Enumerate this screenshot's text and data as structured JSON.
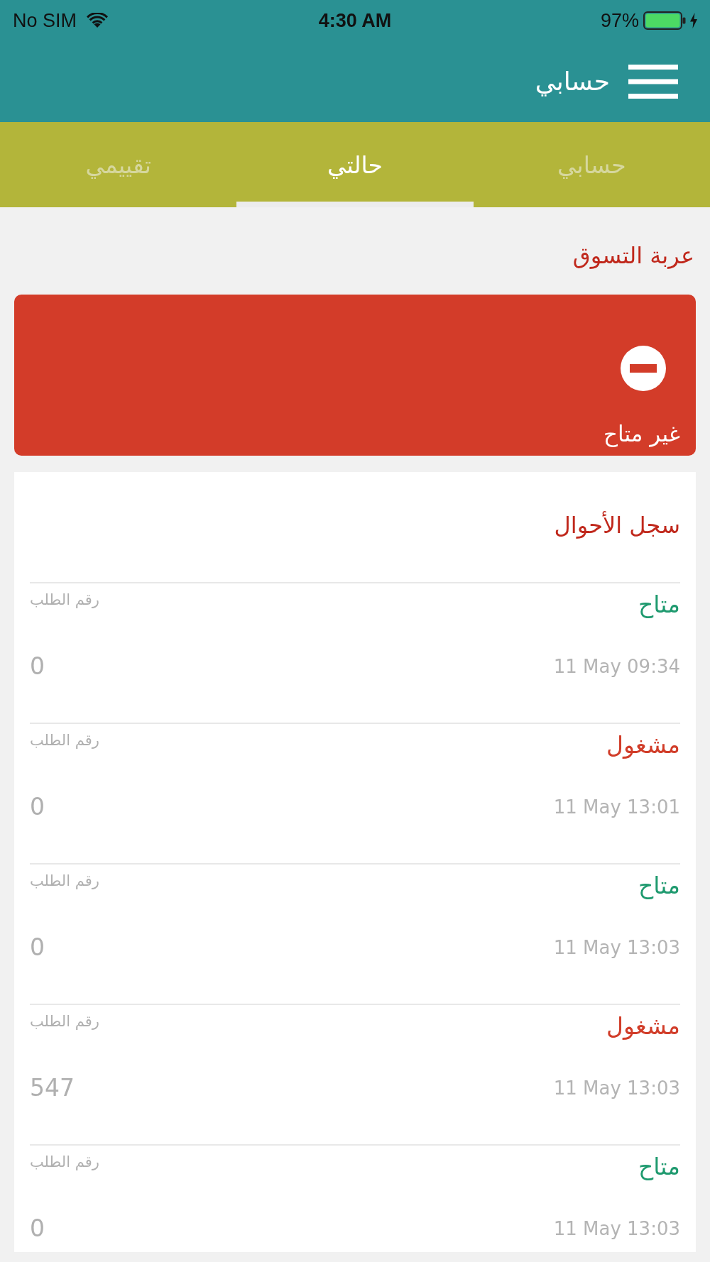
{
  "status_bar": {
    "carrier": "No SIM",
    "time": "4:30 AM",
    "battery": "97%"
  },
  "header": {
    "title": "حسابي"
  },
  "tabs": [
    {
      "label": "حسابي",
      "selected": false
    },
    {
      "label": "حالتي",
      "selected": true
    },
    {
      "label": "تقييمي",
      "selected": false
    }
  ],
  "cart": {
    "title": "عربة التسوق",
    "kind": "unavailable",
    "status": "غير متاح"
  },
  "history": {
    "title": "سجل الأحوال",
    "entries": [
      {
        "status": "متاح",
        "color": "#1f9a6f",
        "order_label": "رقم الطلب",
        "time": "11 May 09:34",
        "order_number": "0"
      },
      {
        "status": "مشغول",
        "color": "#d13d29",
        "order_label": "رقم الطلب",
        "time": "11 May 13:01",
        "order_number": "0"
      },
      {
        "status": "متاح",
        "color": "#1f9a6f",
        "order_label": "رقم الطلب",
        "time": "11 May 13:03",
        "order_number": "0"
      },
      {
        "status": "مشغول",
        "color": "#d13d29",
        "order_label": "رقم الطلب",
        "time": "11 May 13:03",
        "order_number": "547"
      },
      {
        "status": "متاح",
        "color": "#1f9a6f",
        "order_label": "رقم الطلب",
        "time": "11 May 13:03",
        "order_number": "0"
      }
    ]
  }
}
